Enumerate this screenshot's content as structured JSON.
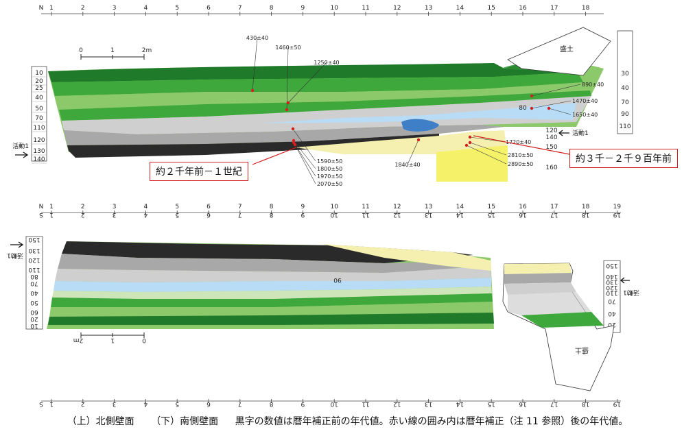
{
  "north": {
    "label": "N",
    "grid": [
      "1",
      "2",
      "3",
      "4",
      "5",
      "6",
      "7",
      "8",
      "9",
      "10",
      "11",
      "12",
      "13",
      "14",
      "15",
      "16",
      "17",
      "18"
    ],
    "left_depths": [
      "10",
      "20",
      "25",
      "40",
      "50",
      "70",
      "110",
      "120",
      "130",
      "140"
    ],
    "right_depths": [
      "30",
      "40",
      "70",
      "90",
      "110"
    ],
    "right_depths_lower": [
      "120",
      "140",
      "150",
      "160"
    ],
    "fill_label": "盛土",
    "scale": {
      "zero": "0",
      "one": "1",
      "two": "2m"
    },
    "event_label": "活動1",
    "dates": [
      "430±40",
      "1460±50",
      "1250±40",
      "890±40",
      "1470±40",
      "1650±40",
      "1720±40",
      "2810±50",
      "2890±50",
      "1840±40",
      "1590±50",
      "1800±50",
      "1970±50",
      "2070±50"
    ],
    "mid_label": "80",
    "callout_left": "約２千年前－１世紀",
    "callout_right": "約３千－２千９百年前"
  },
  "south": {
    "labels": [
      "N",
      "S"
    ],
    "grid_top": [
      "1",
      "2",
      "3",
      "4",
      "5",
      "6",
      "7",
      "8",
      "9",
      "10",
      "11",
      "12",
      "13",
      "14",
      "15",
      "16",
      "17",
      "18",
      "19"
    ],
    "left_depths": [
      "150",
      "130",
      "120",
      "110",
      "80",
      "70",
      "40",
      "50",
      "60",
      "20",
      "10"
    ],
    "right_depths": [
      "150",
      "140",
      "130",
      "120",
      "110",
      "70",
      "40",
      "20"
    ],
    "fill_label": "盛土",
    "scale": {
      "zero": "0",
      "one": "1",
      "two": "2m"
    },
    "event_label": "活動1",
    "mid_label": "90"
  },
  "caption": {
    "upper": "（上）北側壁面",
    "lower": "（下）南側壁面",
    "note": "黒字の数値は暦年補正前の年代値。赤い線の囲み内は暦年補正（注 11 参照）後の年代値。"
  },
  "colors": {
    "dark_green": "#1f7a2a",
    "green": "#3ea83c",
    "light_green": "#8cc96a",
    "pale_green": "#cde5b8",
    "grey": "#a8a8a8",
    "light_grey": "#cfcfcf",
    "black": "#2a2a2a",
    "light_blue": "#b8dcf5",
    "blue": "#3f7fc8",
    "yellow": "#f5f26a",
    "pale_yellow": "#f5f0b0",
    "red": "#d21f1f"
  }
}
